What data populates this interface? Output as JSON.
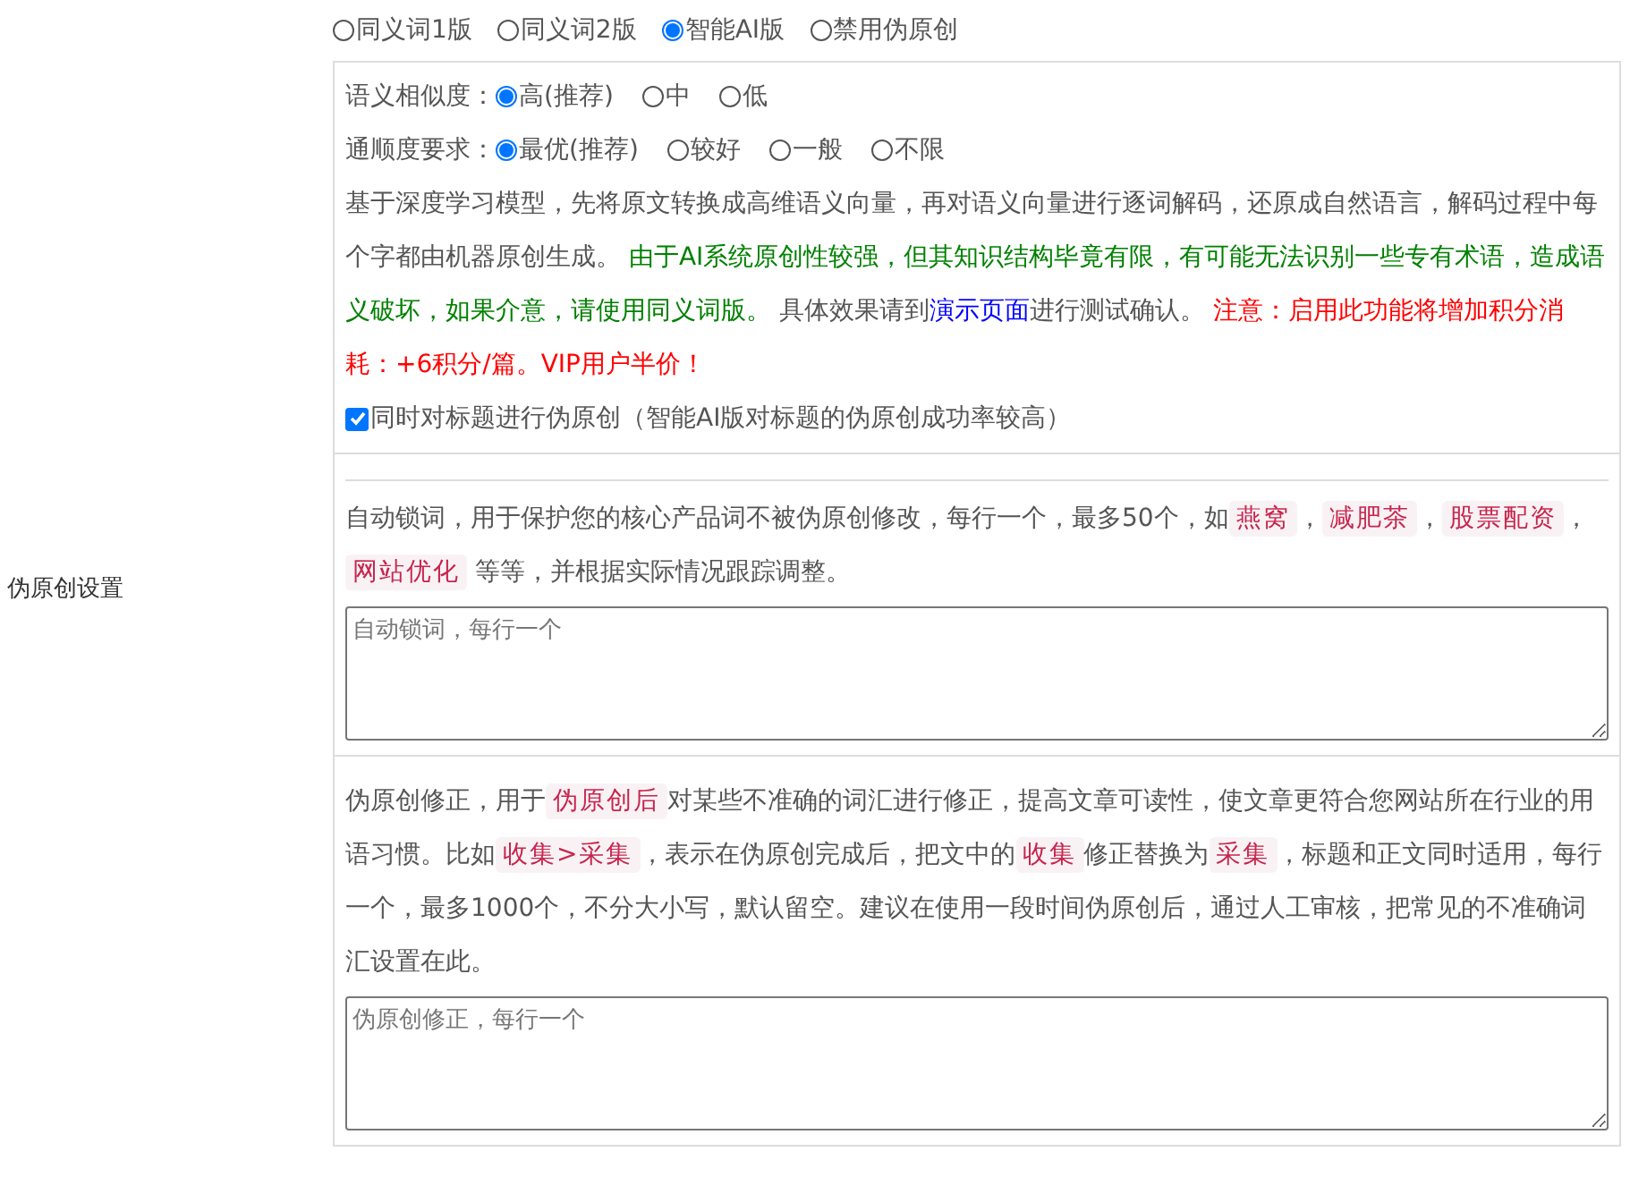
{
  "section_label": "伪原创设置",
  "modes": [
    {
      "label": "同义词1版",
      "selected": false
    },
    {
      "label": "同义词2版",
      "selected": false
    },
    {
      "label": "智能AI版",
      "selected": true
    },
    {
      "label": "禁用伪原创",
      "selected": false
    }
  ],
  "ai_settings": {
    "rows": [
      {
        "label": "语义相似度：",
        "options": [
          {
            "label": "高(推荐)",
            "selected": true
          },
          {
            "label": "中",
            "selected": false
          },
          {
            "label": "低",
            "selected": false
          }
        ]
      },
      {
        "label": "通顺度要求：",
        "options": [
          {
            "label": "最优(推荐)",
            "selected": true
          },
          {
            "label": "较好",
            "selected": false
          },
          {
            "label": "一般",
            "selected": false
          },
          {
            "label": "不限",
            "selected": false
          }
        ]
      }
    ],
    "description": [
      {
        "kind": "text",
        "text": "基于深度学习模型，先将原文转换成高维语义向量，再对语义向量进行逐词解码，还原成自然语言，解码过程中每个字都由机器原创生成。 "
      },
      {
        "kind": "green",
        "text": "由于AI系统原创性较强，但其知识结构毕竟有限，有可能无法识别一些专有术语，造成语义破坏，如果介意，请使用同义词版。"
      },
      {
        "kind": "text",
        "text": " 具体效果请到"
      },
      {
        "kind": "link",
        "text": "演示页面"
      },
      {
        "kind": "text",
        "text": "进行测试确认。 "
      },
      {
        "kind": "red",
        "text": "注意：启用此功能将增加积分消耗：+6积分/篇。VIP用户半价！"
      }
    ],
    "title_checkbox": {
      "label": "同时对标题进行伪原创（智能AI版对标题的伪原创成功率较高）",
      "checked": true
    }
  },
  "lock_words": {
    "description": [
      {
        "kind": "text",
        "text": "自动锁词，用于保护您的核心产品词不被伪原创修改，每行一个，最多50个，如"
      },
      {
        "kind": "tag",
        "text": "燕窝"
      },
      {
        "kind": "text",
        "text": "，"
      },
      {
        "kind": "tag",
        "text": "减肥茶"
      },
      {
        "kind": "text",
        "text": "，"
      },
      {
        "kind": "tag",
        "text": "股票配资"
      },
      {
        "kind": "text",
        "text": "，"
      },
      {
        "kind": "tag",
        "text": "网站优化"
      },
      {
        "kind": "text",
        "text": " 等等，并根据实际情况跟踪调整。"
      }
    ],
    "placeholder": "自动锁词，每行一个"
  },
  "corrections": {
    "description": [
      {
        "kind": "text",
        "text": "伪原创修正，用于"
      },
      {
        "kind": "tag",
        "text": "伪原创后"
      },
      {
        "kind": "text",
        "text": "对某些不准确的词汇进行修正，提高文章可读性，使文章更符合您网站所在行业的用语习惯。比如"
      },
      {
        "kind": "tag",
        "text": "收集>采集"
      },
      {
        "kind": "text",
        "text": "，表示在伪原创完成后，把文中的"
      },
      {
        "kind": "tag",
        "text": "收集"
      },
      {
        "kind": "text",
        "text": "修正替换为"
      },
      {
        "kind": "tag",
        "text": "采集"
      },
      {
        "kind": "text",
        "text": "，标题和正文同时适用，每行一个，最多1000个，不分大小写，默认留空。建议在使用一段时间伪原创后，通过人工审核，把常见的不准确词汇设置在此。"
      }
    ],
    "placeholder": "伪原创修正，每行一个"
  }
}
